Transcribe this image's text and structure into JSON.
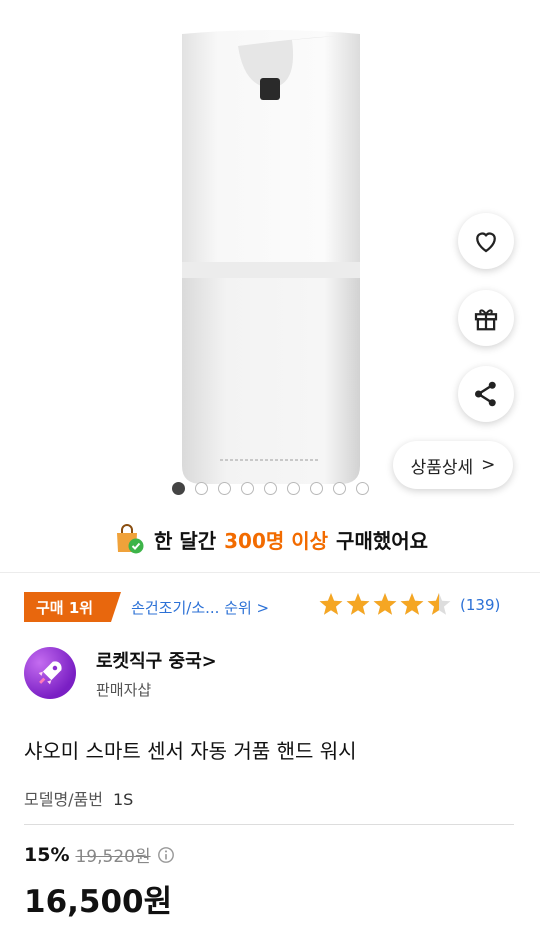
{
  "product_image": {
    "label": "샤오미 자동 거품 핸드워시 디스펜서"
  },
  "gallery": {
    "total_dots": 9,
    "active_index": 0
  },
  "actions": {
    "detail_label": "상품상세",
    "detail_arrow": ">"
  },
  "purchase_note": {
    "pre": "한 달간",
    "highlight": "300명 이상",
    "post": "구매했어요"
  },
  "ranking": {
    "badge": "구매 1위",
    "link": "손건조기/소... 순위 >"
  },
  "rating": {
    "stars": 4.5,
    "review_count": "(139)"
  },
  "seller": {
    "name": "로켓직구 중국>",
    "subtitle": "판매자샵"
  },
  "product": {
    "title": "샤오미 스마트 센서 자동 거품 핸드 워시",
    "model_label": "모델명/품번",
    "model_value": "1S"
  },
  "price": {
    "discount": "15%",
    "original": "19,520원",
    "current": "16,500원"
  },
  "colors": {
    "accent": "#f26b00",
    "rank_badge": "#e8670d",
    "star": "#f5a623",
    "link": "#2c71d6"
  }
}
